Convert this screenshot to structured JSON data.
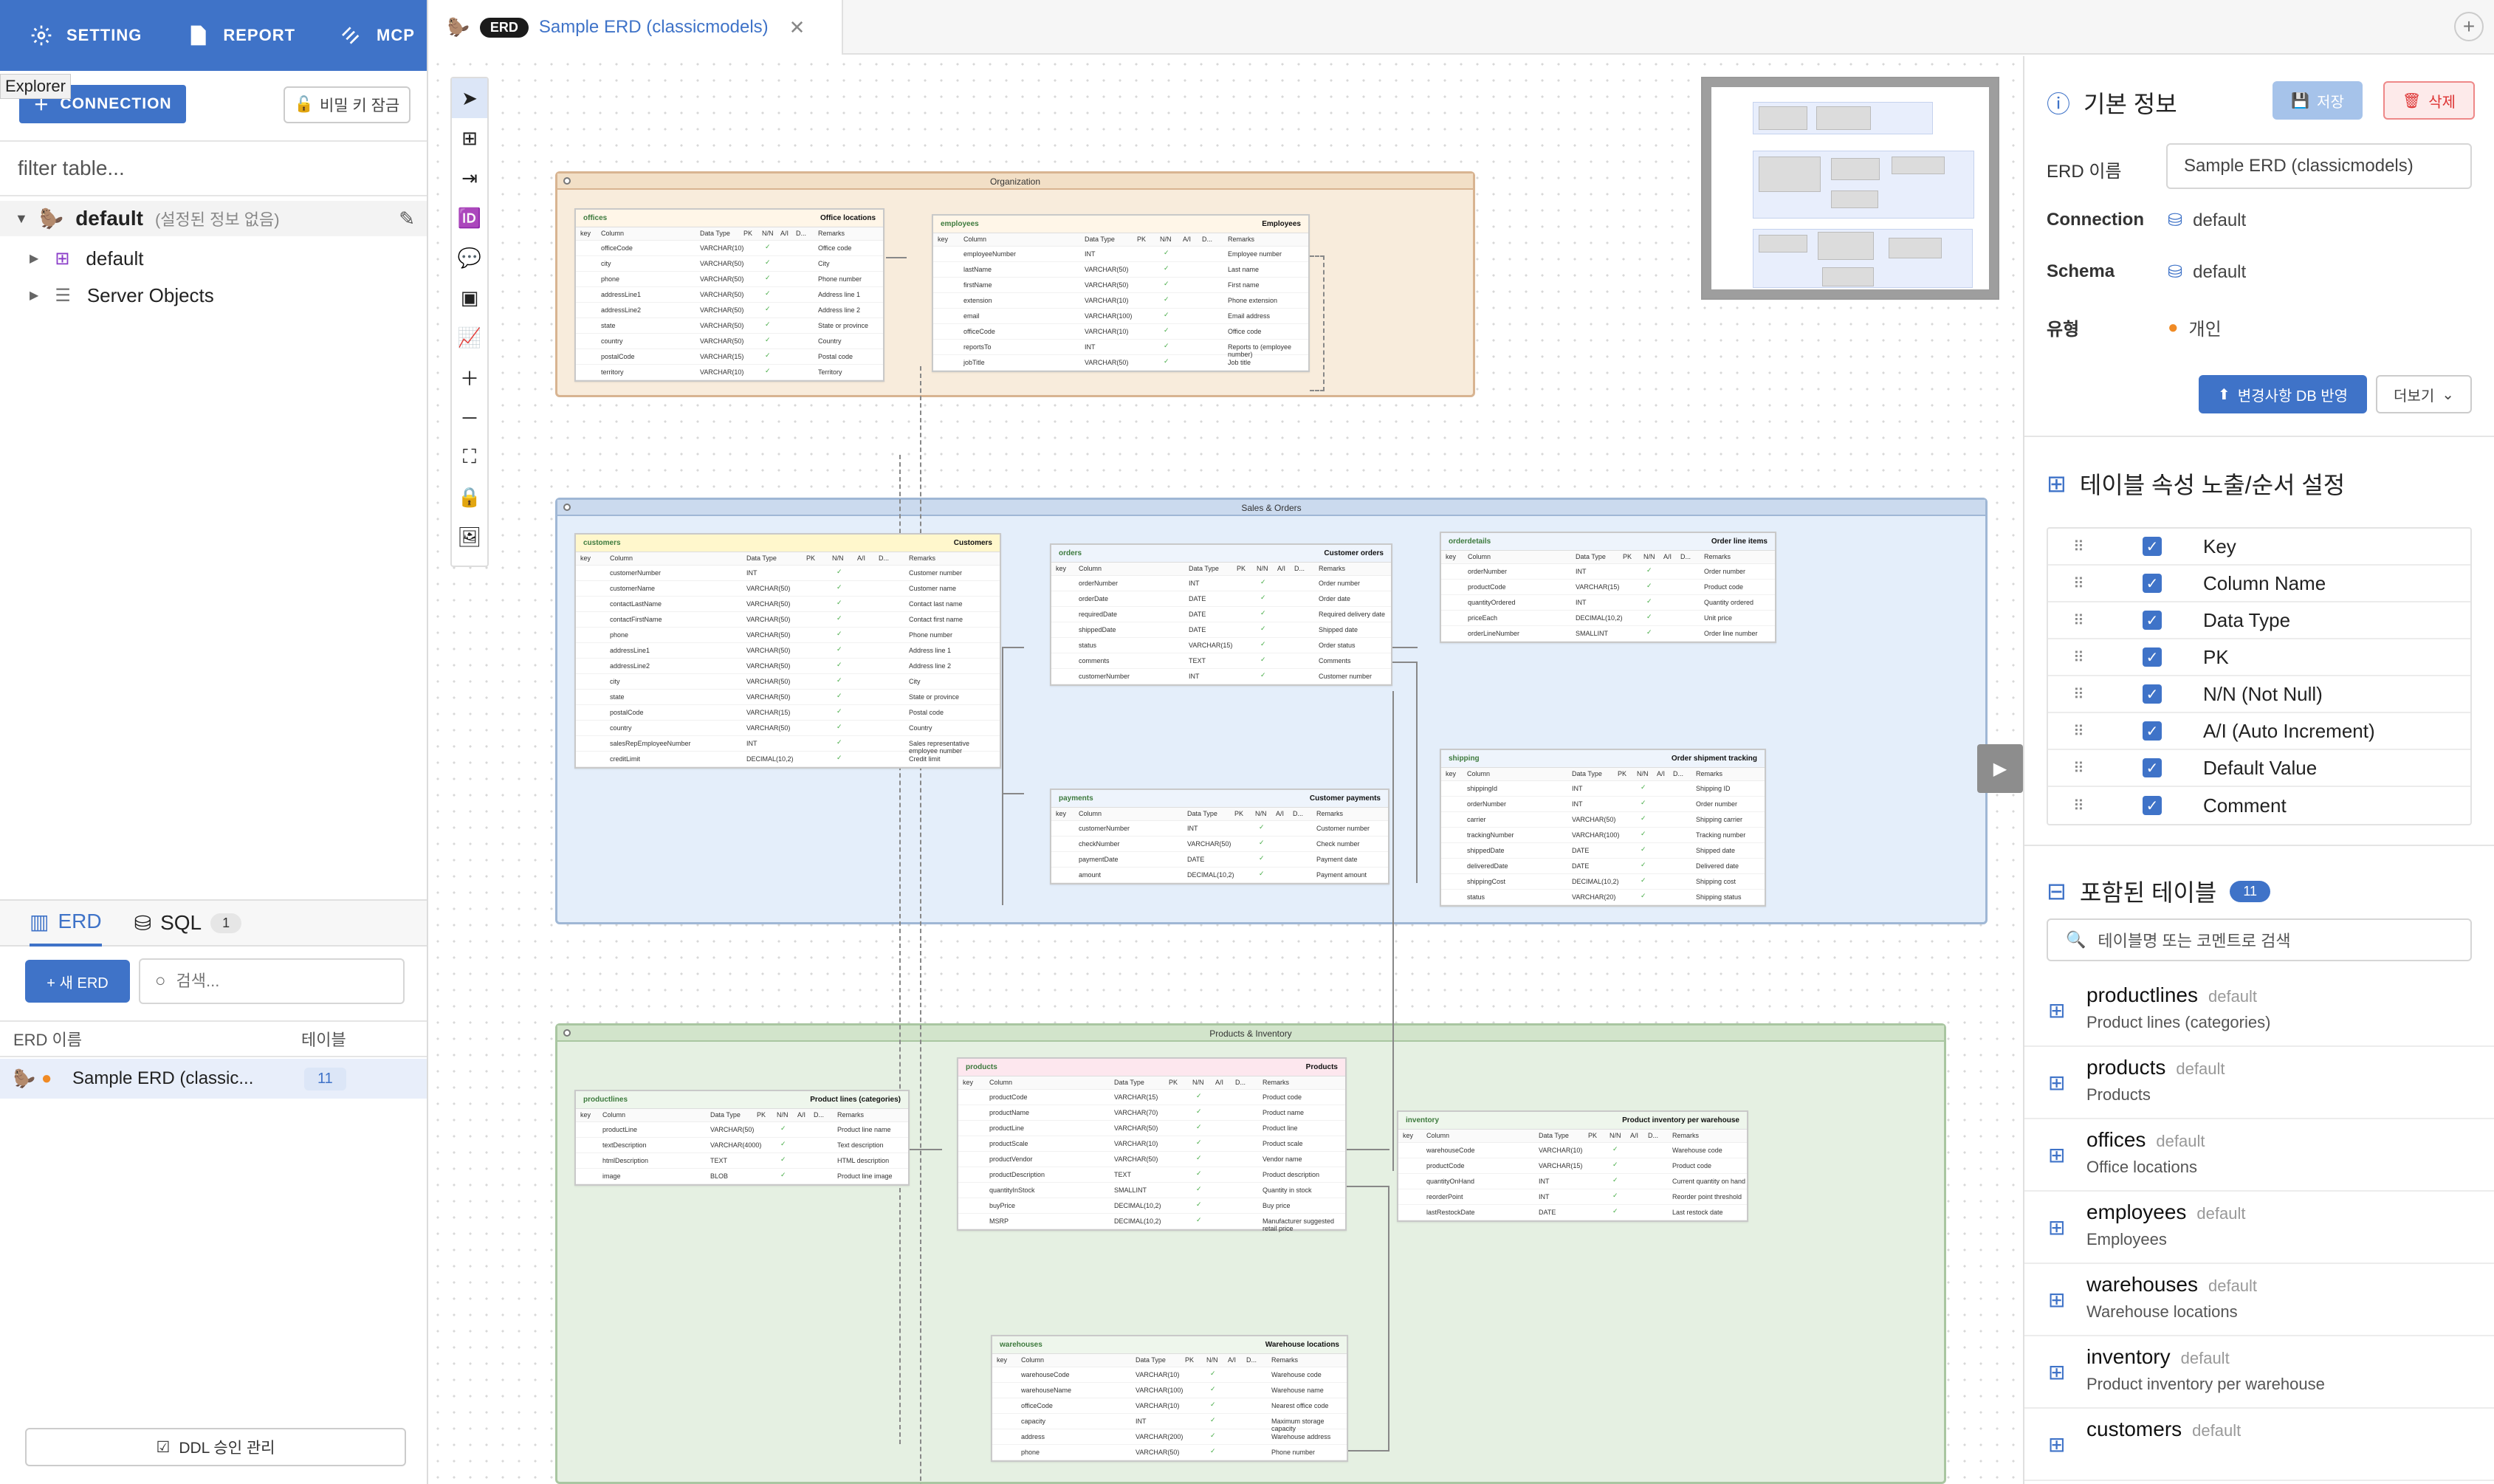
{
  "nav": {
    "setting": "SETTING",
    "report": "REPORT",
    "mcp": "MCP"
  },
  "explorer_tooltip": "Explorer",
  "connection_button": "CONNECTION",
  "secret_button": "비밀 키 잠금",
  "filter": {
    "placeholder": "filter table..."
  },
  "tree": {
    "root_name": "default",
    "root_note": "(설정된 정보 없음)",
    "db_name": "default",
    "server_objects": "Server Objects"
  },
  "left_tabs": {
    "erd": "ERD",
    "sql": "SQL",
    "sql_count": "1"
  },
  "new_erd_button": "+ 새 ERD",
  "erd_search": {
    "placeholder": "검색..."
  },
  "erd_list": {
    "col_name": "ERD 이름",
    "col_tables": "테이블",
    "rows": [
      {
        "name": "Sample ERD (classic...",
        "tables": "11"
      }
    ]
  },
  "ddl_button": "DDL 승인 관리",
  "doc_tab": {
    "badge": "ERD",
    "title": "Sample ERD (classicmodels)"
  },
  "canvas": {
    "groups": {
      "org": "Organization",
      "sales": "Sales & Orders",
      "prod": "Products & Inventory"
    },
    "col_headers": [
      "key",
      "Column",
      "Data Type",
      "PK",
      "N/N",
      "A/I",
      "D...",
      "Remarks"
    ],
    "tables": {
      "offices": {
        "name": "offices",
        "comment": "Office locations",
        "rows": [
          [
            "officeCode",
            "VARCHAR(10)",
            "Office code"
          ],
          [
            "city",
            "VARCHAR(50)",
            "City"
          ],
          [
            "phone",
            "VARCHAR(50)",
            "Phone number"
          ],
          [
            "addressLine1",
            "VARCHAR(50)",
            "Address line 1"
          ],
          [
            "addressLine2",
            "VARCHAR(50)",
            "Address line 2"
          ],
          [
            "state",
            "VARCHAR(50)",
            "State or province"
          ],
          [
            "country",
            "VARCHAR(50)",
            "Country"
          ],
          [
            "postalCode",
            "VARCHAR(15)",
            "Postal code"
          ],
          [
            "territory",
            "VARCHAR(10)",
            "Territory"
          ]
        ]
      },
      "employees": {
        "name": "employees",
        "comment": "Employees",
        "rows": [
          [
            "employeeNumber",
            "INT",
            "Employee number"
          ],
          [
            "lastName",
            "VARCHAR(50)",
            "Last name"
          ],
          [
            "firstName",
            "VARCHAR(50)",
            "First name"
          ],
          [
            "extension",
            "VARCHAR(10)",
            "Phone extension"
          ],
          [
            "email",
            "VARCHAR(100)",
            "Email address"
          ],
          [
            "officeCode",
            "VARCHAR(10)",
            "Office code"
          ],
          [
            "reportsTo",
            "INT",
            "Reports to (employee number)"
          ],
          [
            "jobTitle",
            "VARCHAR(50)",
            "Job title"
          ]
        ]
      },
      "customers": {
        "name": "customers",
        "comment": "Customers",
        "rows": [
          [
            "customerNumber",
            "INT",
            "Customer number"
          ],
          [
            "customerName",
            "VARCHAR(50)",
            "Customer name"
          ],
          [
            "contactLastName",
            "VARCHAR(50)",
            "Contact last name"
          ],
          [
            "contactFirstName",
            "VARCHAR(50)",
            "Contact first name"
          ],
          [
            "phone",
            "VARCHAR(50)",
            "Phone number"
          ],
          [
            "addressLine1",
            "VARCHAR(50)",
            "Address line 1"
          ],
          [
            "addressLine2",
            "VARCHAR(50)",
            "Address line 2"
          ],
          [
            "city",
            "VARCHAR(50)",
            "City"
          ],
          [
            "state",
            "VARCHAR(50)",
            "State or province"
          ],
          [
            "postalCode",
            "VARCHAR(15)",
            "Postal code"
          ],
          [
            "country",
            "VARCHAR(50)",
            "Country"
          ],
          [
            "salesRepEmployeeNumber",
            "INT",
            "Sales representative employee number"
          ],
          [
            "creditLimit",
            "DECIMAL(10,2)",
            "Credit limit"
          ]
        ]
      },
      "orders": {
        "name": "orders",
        "comment": "Customer orders",
        "rows": [
          [
            "orderNumber",
            "INT",
            "Order number"
          ],
          [
            "orderDate",
            "DATE",
            "Order date"
          ],
          [
            "requiredDate",
            "DATE",
            "Required delivery date"
          ],
          [
            "shippedDate",
            "DATE",
            "Shipped date"
          ],
          [
            "status",
            "VARCHAR(15)",
            "Order status"
          ],
          [
            "comments",
            "TEXT",
            "Comments"
          ],
          [
            "customerNumber",
            "INT",
            "Customer number"
          ]
        ]
      },
      "orderdetails": {
        "name": "orderdetails",
        "comment": "Order line items",
        "rows": [
          [
            "orderNumber",
            "INT",
            "Order number"
          ],
          [
            "productCode",
            "VARCHAR(15)",
            "Product code"
          ],
          [
            "quantityOrdered",
            "INT",
            "Quantity ordered"
          ],
          [
            "priceEach",
            "DECIMAL(10,2)",
            "Unit price"
          ],
          [
            "orderLineNumber",
            "SMALLINT",
            "Order line number"
          ]
        ]
      },
      "payments": {
        "name": "payments",
        "comment": "Customer payments",
        "rows": [
          [
            "customerNumber",
            "INT",
            "Customer number"
          ],
          [
            "checkNumber",
            "VARCHAR(50)",
            "Check number"
          ],
          [
            "paymentDate",
            "DATE",
            "Payment date"
          ],
          [
            "amount",
            "DECIMAL(10,2)",
            "Payment amount"
          ]
        ]
      },
      "shipping": {
        "name": "shipping",
        "comment": "Order shipment tracking",
        "rows": [
          [
            "shippingId",
            "INT",
            "Shipping ID"
          ],
          [
            "orderNumber",
            "INT",
            "Order number"
          ],
          [
            "carrier",
            "VARCHAR(50)",
            "Shipping carrier"
          ],
          [
            "trackingNumber",
            "VARCHAR(100)",
            "Tracking number"
          ],
          [
            "shippedDate",
            "DATE",
            "Shipped date"
          ],
          [
            "deliveredDate",
            "DATE",
            "Delivered date"
          ],
          [
            "shippingCost",
            "DECIMAL(10,2)",
            "Shipping cost"
          ],
          [
            "status",
            "VARCHAR(20)",
            "Shipping status"
          ]
        ]
      },
      "productlines": {
        "name": "productlines",
        "comment": "Product lines (categories)",
        "rows": [
          [
            "productLine",
            "VARCHAR(50)",
            "Product line name"
          ],
          [
            "textDescription",
            "VARCHAR(4000)",
            "Text description"
          ],
          [
            "htmlDescription",
            "TEXT",
            "HTML description"
          ],
          [
            "image",
            "BLOB",
            "Product line image"
          ]
        ]
      },
      "products": {
        "name": "products",
        "comment": "Products",
        "rows": [
          [
            "productCode",
            "VARCHAR(15)",
            "Product code"
          ],
          [
            "productName",
            "VARCHAR(70)",
            "Product name"
          ],
          [
            "productLine",
            "VARCHAR(50)",
            "Product line"
          ],
          [
            "productScale",
            "VARCHAR(10)",
            "Product scale"
          ],
          [
            "productVendor",
            "VARCHAR(50)",
            "Vendor name"
          ],
          [
            "productDescription",
            "TEXT",
            "Product description"
          ],
          [
            "quantityInStock",
            "SMALLINT",
            "Quantity in stock"
          ],
          [
            "buyPrice",
            "DECIMAL(10,2)",
            "Buy price"
          ],
          [
            "MSRP",
            "DECIMAL(10,2)",
            "Manufacturer suggested retail price"
          ]
        ]
      },
      "inventory": {
        "name": "inventory",
        "comment": "Product inventory per warehouse",
        "rows": [
          [
            "warehouseCode",
            "VARCHAR(10)",
            "Warehouse code"
          ],
          [
            "productCode",
            "VARCHAR(15)",
            "Product code"
          ],
          [
            "quantityOnHand",
            "INT",
            "Current quantity on hand"
          ],
          [
            "reorderPoint",
            "INT",
            "Reorder point threshold"
          ],
          [
            "lastRestockDate",
            "DATE",
            "Last restock date"
          ]
        ]
      },
      "warehouses": {
        "name": "warehouses",
        "comment": "Warehouse locations",
        "rows": [
          [
            "warehouseCode",
            "VARCHAR(10)",
            "Warehouse code"
          ],
          [
            "warehouseName",
            "VARCHAR(100)",
            "Warehouse name"
          ],
          [
            "officeCode",
            "VARCHAR(10)",
            "Nearest office code"
          ],
          [
            "capacity",
            "INT",
            "Maximum storage capacity"
          ],
          [
            "address",
            "VARCHAR(200)",
            "Warehouse address"
          ],
          [
            "phone",
            "VARCHAR(50)",
            "Phone number"
          ]
        ]
      }
    }
  },
  "right": {
    "info_title": "기본 정보",
    "save": "저장",
    "delete": "삭제",
    "erd_name_label": "ERD 이름",
    "erd_name_value": "Sample ERD (classicmodels)",
    "connection_label": "Connection",
    "connection_value": "default",
    "schema_label": "Schema",
    "schema_value": "default",
    "type_label": "유형",
    "type_value": "개인",
    "apply_button": "변경사항 DB 반영",
    "more_button": "더보기",
    "props_title": "테이블 속성 노출/순서 설정",
    "props": [
      "Key",
      "Column Name",
      "Data Type",
      "PK",
      "N/N (Not Null)",
      "A/I (Auto Increment)",
      "Default Value",
      "Comment"
    ],
    "included_title": "포함된 테이블",
    "included_count": "11",
    "included_search_placeholder": "테이블명 또는 코멘트로 검색",
    "included": [
      {
        "name": "productlines",
        "schema": "default",
        "comment": "Product lines (categories)"
      },
      {
        "name": "products",
        "schema": "default",
        "comment": "Products"
      },
      {
        "name": "offices",
        "schema": "default",
        "comment": "Office locations"
      },
      {
        "name": "employees",
        "schema": "default",
        "comment": "Employees"
      },
      {
        "name": "warehouses",
        "schema": "default",
        "comment": "Warehouse locations"
      },
      {
        "name": "inventory",
        "schema": "default",
        "comment": "Product inventory per warehouse"
      },
      {
        "name": "customers",
        "schema": "default",
        "comment": ""
      }
    ]
  },
  "colors": {
    "accent": "#3f73c8",
    "org_group": "#f8ecdc",
    "sales_group": "#e4eefa",
    "prod_group": "#e5f0e2",
    "danger": "#dd3333"
  }
}
